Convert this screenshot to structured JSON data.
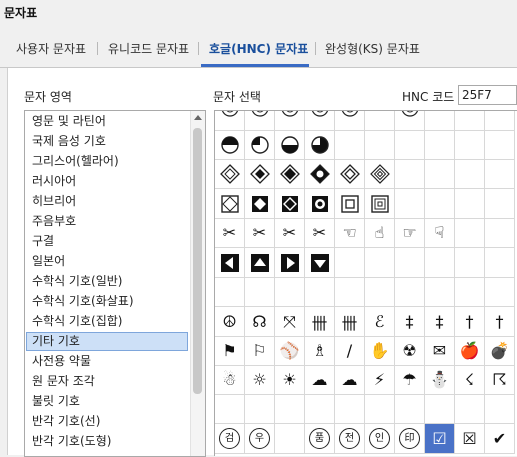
{
  "window": {
    "title": "문자표"
  },
  "tabs": [
    {
      "label": "사용자 문자표",
      "active": false
    },
    {
      "label": "유니코드 문자표",
      "active": false
    },
    {
      "label": "호글(HNC) 문자표",
      "active": true
    },
    {
      "label": "완성형(KS) 문자표",
      "active": false
    }
  ],
  "area_label": "문자 영역",
  "select_label": "문자 선택",
  "hnc_code": {
    "label": "HNC 코드",
    "value": "25F7"
  },
  "categories": [
    "영문 및 라틴어",
    "국제 음성 기호",
    "그리스어(헬라어)",
    "러시아어",
    "히브리어",
    "주음부호",
    "구결",
    "일본어",
    "수학식 기호(일반)",
    "수학식 기호(화살표)",
    "수학식 기호(집합)",
    "기타 기호",
    "사전용 약물",
    "원 문자 조각",
    "불릿 기호",
    "반각 기호(선)",
    "반각 기호(도형)"
  ],
  "selected_category": "기타 기호",
  "grid": {
    "rows": [
      [
        "circ-partial",
        "circ-partial",
        "circ-partial",
        "circ-partial",
        "circ-partial",
        "",
        "circ-partial",
        "",
        "",
        ""
      ],
      [
        "circ-tophalf",
        "circ-quarter",
        "circ-bothalf",
        "circ-threeq",
        "",
        "",
        "",
        "",
        "",
        ""
      ],
      [
        "dia-in-dia",
        "dia-4dots",
        "dia-black",
        "dia-3quad",
        "dia-double",
        "dia-triple",
        "",
        "",
        "",
        ""
      ],
      [
        "sq-dia",
        "sq-4dots",
        "sq-black",
        "sq-circle",
        "sq-sq",
        "sq-sq2",
        "",
        "",
        "",
        ""
      ],
      [
        "✂",
        "✂",
        "✂",
        "✂",
        "☜",
        "☝",
        "☞",
        "☟",
        "",
        ""
      ],
      [
        "◀",
        "▲",
        "▶",
        "▼",
        "",
        "",
        "",
        "",
        "",
        ""
      ],
      [
        "",
        "",
        "",
        "",
        "",
        "",
        "",
        "",
        "",
        ""
      ],
      [
        "☮",
        "☊",
        "⤧",
        "卌",
        "卌",
        "ℰ",
        "‡",
        "‡",
        "†",
        "†"
      ],
      [
        "⚑",
        "⚐",
        "⚾",
        "♗",
        "/",
        "✋",
        "☢",
        "✉",
        "🍎",
        "💣"
      ],
      [
        "☃",
        "☼",
        "☀",
        "☁",
        "☁",
        "⚡",
        "☂",
        "⛄",
        "☇",
        "☈"
      ],
      [
        "",
        "",
        "",
        "",
        "",
        "",
        "",
        "",
        "",
        ""
      ],
      [
        "ⓢ",
        "ⓞ",
        "⛆",
        "ⓢ",
        "ⓢ",
        "ⓢ",
        "ⓢ",
        "☑",
        "☒",
        "✔"
      ]
    ],
    "circled": [
      "검",
      "우",
      "",
      "품",
      "전",
      "인",
      "印",
      "☑",
      "☒",
      "✔"
    ],
    "selected_symbol": "☑"
  }
}
